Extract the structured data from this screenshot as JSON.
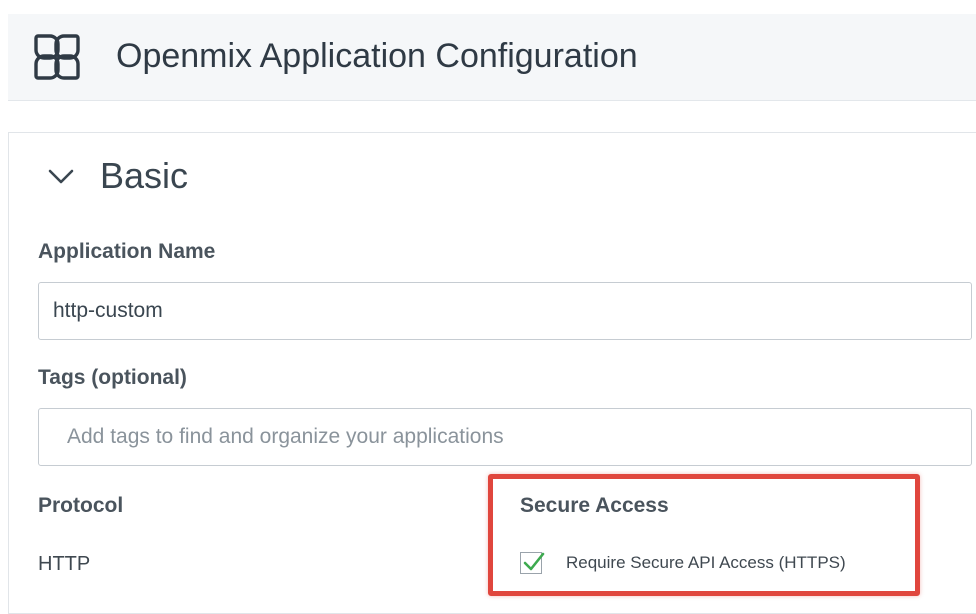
{
  "header": {
    "title": "Openmix Application Configuration",
    "logo_icon": "openmix-logo-icon"
  },
  "section": {
    "title": "Basic",
    "toggle_icon": "chevron-down-icon",
    "expanded": true
  },
  "fields": {
    "application_name": {
      "label": "Application Name",
      "value": "http-custom"
    },
    "tags": {
      "label": "Tags (optional)",
      "value": "",
      "placeholder": "Add tags to find and organize your applications"
    },
    "protocol": {
      "label": "Protocol",
      "value": "HTTP"
    },
    "secure_access": {
      "label": "Secure Access",
      "checkbox_label": "Require Secure API Access (HTTPS)",
      "checked": true
    }
  },
  "colors": {
    "highlight_border": "#e0463d",
    "checkmark": "#3daa4f",
    "header_background": "#f5f7f9"
  }
}
